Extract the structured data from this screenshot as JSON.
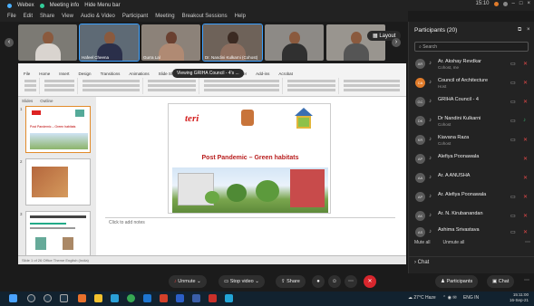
{
  "window": {
    "app_name": "Webex",
    "meeting_info": "Meeting info",
    "hide_menu": "Hide Menu bar",
    "time": "15:10",
    "menu": [
      "File",
      "Edit",
      "Share",
      "View",
      "Audio & Video",
      "Participant",
      "Meeting",
      "Breakout Sessions",
      "Help"
    ]
  },
  "videos": [
    {
      "label": ""
    },
    {
      "label": "Hafeel Cheena"
    },
    {
      "label": "Gurra Lal"
    },
    {
      "label": "Dr. Nandini Kulkarni (Cohost)"
    },
    {
      "label": ""
    },
    {
      "label": ""
    }
  ],
  "layout_label": "Layout",
  "ppt": {
    "tabs": [
      "File",
      "Home",
      "Insert",
      "Design",
      "Transitions",
      "Animations",
      "Slide Show",
      "Review",
      "View",
      "Developer",
      "Add-ins",
      "Acrobat"
    ],
    "viewing_label": "Viewing GRIHA Council - 4's ...",
    "thumb_tabs": [
      "Slides",
      "Outline"
    ],
    "slide_title": "Post Pandemic – Green habitats",
    "thumb_caption": "Post Pandemic – Green habitats",
    "notes_placeholder": "Click to add notes",
    "status": "Slide 1 of 26   Office Theme   English (India)"
  },
  "participants": {
    "header": "Participants (20)",
    "search_placeholder": "Search",
    "list": [
      {
        "initials": "AR",
        "name": "Ar. Akshay Revdkar",
        "role": "Cohost, me"
      },
      {
        "initials": "CA",
        "name": "Council of Architecture",
        "role": "Host"
      },
      {
        "initials": "GC",
        "name": "GRIHA Council - 4",
        "role": ""
      },
      {
        "initials": "DK",
        "name": "Dr Nandini Kulkarni",
        "role": "Cohost"
      },
      {
        "initials": "KR",
        "name": "Kiavana Raza",
        "role": "Cohost"
      },
      {
        "initials": "AP",
        "name": "Alefiya Poonawala",
        "role": ""
      },
      {
        "initials": "AA",
        "name": "Ar. A ANUSHA",
        "role": ""
      },
      {
        "initials": "AP",
        "name": "Ar. Alefiya Poonawala",
        "role": ""
      },
      {
        "initials": "AK",
        "name": "Ar. N. Kirubanandan",
        "role": ""
      },
      {
        "initials": "AS",
        "name": "Ashima Srivastava",
        "role": ""
      }
    ],
    "mute_all": "Mute all",
    "unmute_all": "Unmute all",
    "chat_label": "Chat"
  },
  "controls": {
    "unmute": "Unmute",
    "stop_video": "Stop video",
    "share": "Share",
    "participants": "Participants",
    "chat": "Chat"
  },
  "taskbar": {
    "weather": "27°C Haze",
    "lang": "ENG IN",
    "time": "15:11:00",
    "date": "16-Sep-21"
  },
  "colors": {
    "accent": "#3aa0ff",
    "mute_red": "#e04848",
    "leave_red": "#d8262d"
  }
}
